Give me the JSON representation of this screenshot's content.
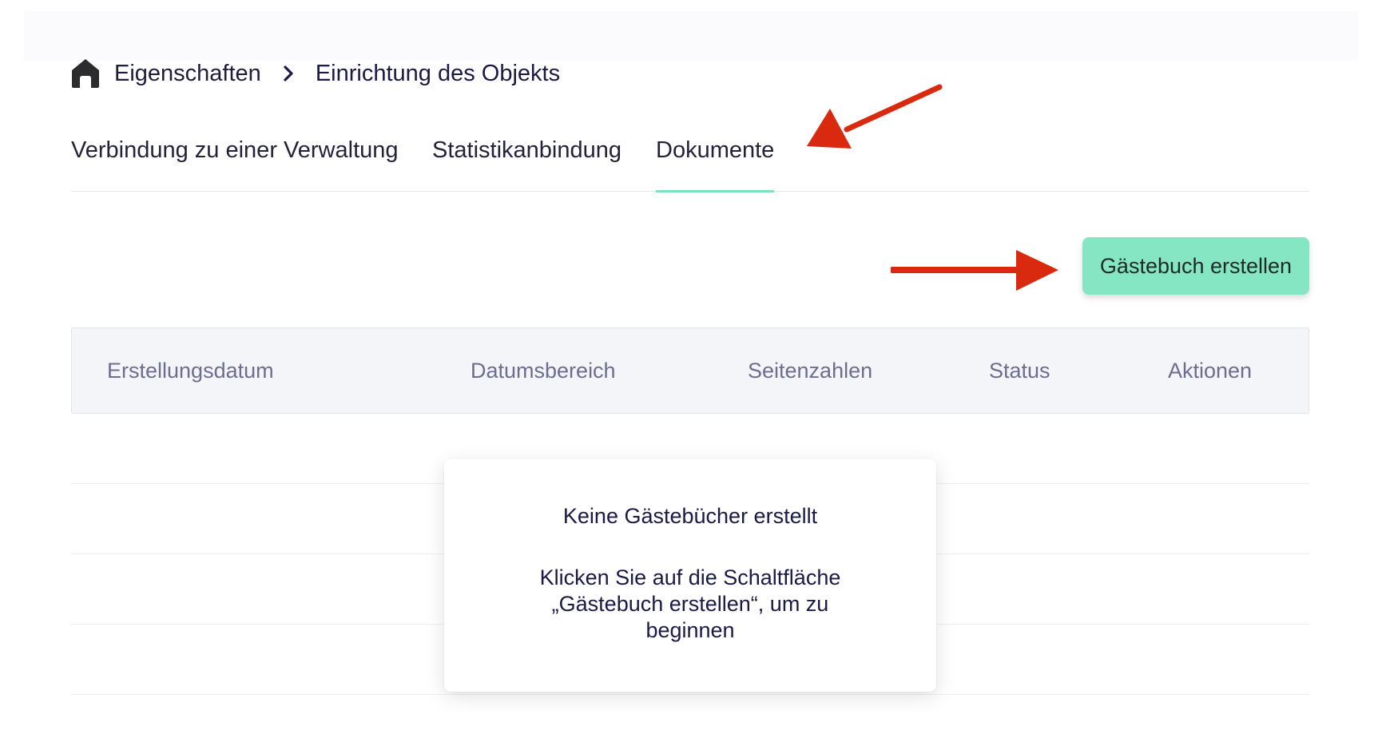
{
  "breadcrumb": {
    "home_icon": "home-icon",
    "separator_icon": "chevron-right-icon",
    "items": [
      "Eigenschaften",
      "Einrichtung des Objekts"
    ]
  },
  "tabs": [
    {
      "label": "Verbindung zu einer Verwaltung",
      "active": false
    },
    {
      "label": "Statistikanbindung",
      "active": false
    },
    {
      "label": "Dokumente",
      "active": true
    }
  ],
  "toolbar": {
    "create_label": "Gästebuch erstellen"
  },
  "table": {
    "columns": [
      "Erstellungsdatum",
      "Datumsbereich",
      "Seitenzahlen",
      "Status",
      "Aktionen"
    ],
    "rows": []
  },
  "empty_state": {
    "title": "Keine Gästebücher erstellt",
    "text": "Klicken Sie auf die Schaltfläche „Gästebuch erstellen“, um zu beginnen"
  },
  "colors": {
    "accent": "#84e6c2",
    "active_tab_underline": "#7fe3c1",
    "annotation_arrow": "#d9290f",
    "header_text": "#6e6c91"
  }
}
